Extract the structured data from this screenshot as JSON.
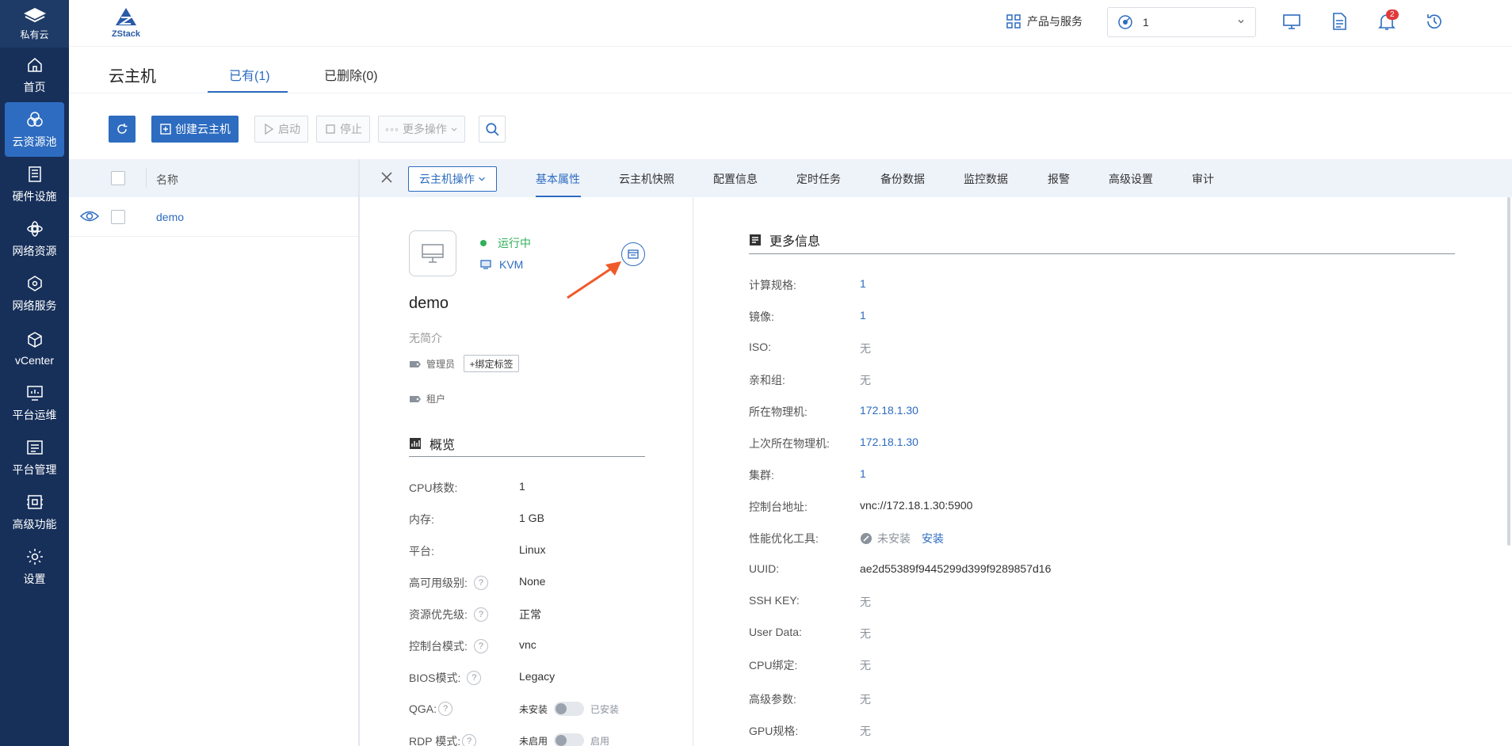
{
  "sidebar": {
    "brand": "私有云",
    "items": [
      {
        "label": "首页",
        "icon": "home-icon"
      },
      {
        "label": "云资源池",
        "icon": "cloud-pool-icon"
      },
      {
        "label": "硬件设施",
        "icon": "hardware-icon"
      },
      {
        "label": "网络资源",
        "icon": "network-resource-icon"
      },
      {
        "label": "网络服务",
        "icon": "network-service-icon"
      },
      {
        "label": "vCenter",
        "icon": "vcenter-icon"
      },
      {
        "label": "平台运维",
        "icon": "ops-icon"
      },
      {
        "label": "平台管理",
        "icon": "management-icon"
      },
      {
        "label": "高级功能",
        "icon": "advanced-icon"
      },
      {
        "label": "设置",
        "icon": "gear-icon"
      }
    ],
    "active_index": 1
  },
  "header": {
    "logo_text": "ZStack",
    "products_label": "产品与服务",
    "zone_value": "1",
    "notification_count": "2"
  },
  "page": {
    "title": "云主机",
    "tabs": [
      {
        "label": "已有(1)"
      },
      {
        "label": "已删除(0)"
      }
    ]
  },
  "toolbar": {
    "create_label": "创建云主机",
    "start_label": "启动",
    "stop_label": "停止",
    "more_label": "更多操作"
  },
  "list": {
    "header_name": "名称",
    "rows": [
      {
        "name": "demo"
      }
    ]
  },
  "detail": {
    "ops_label": "云主机操作",
    "tabs": [
      "基本属性",
      "云主机快照",
      "配置信息",
      "定时任务",
      "备份数据",
      "监控数据",
      "报警",
      "高级设置",
      "审计"
    ],
    "status": "运行中",
    "hypervisor": "KVM",
    "name": "demo",
    "description": "无简介",
    "owner_tag": "管理员",
    "bind_tag_label": "+绑定标签",
    "tenant_tag": "租户",
    "overview_title": "概览",
    "overview": [
      {
        "label": "CPU核数:",
        "value": "1"
      },
      {
        "label": "内存:",
        "value": "1 GB"
      },
      {
        "label": "平台:",
        "value": "Linux"
      },
      {
        "label": "高可用级别:",
        "value": "None"
      },
      {
        "label": "资源优先级:",
        "value": "正常"
      },
      {
        "label": "控制台模式:",
        "value": "vnc"
      },
      {
        "label": "BIOS模式:",
        "value": "Legacy"
      },
      {
        "label": "QGA:",
        "off": "未安装",
        "on": "已安装"
      },
      {
        "label": "RDP 模式:",
        "off": "未启用",
        "on": "启用"
      }
    ],
    "more_title": "更多信息",
    "more": [
      {
        "label": "计算规格:",
        "value": "1"
      },
      {
        "label": "镜像:",
        "value": "1"
      },
      {
        "label": "ISO:",
        "value": "无"
      },
      {
        "label": "亲和组:",
        "value": "无"
      },
      {
        "label": "所在物理机:",
        "value": "172.18.1.30"
      },
      {
        "label": "上次所在物理机:",
        "value": "172.18.1.30"
      },
      {
        "label": "集群:",
        "value": "1"
      },
      {
        "label": "控制台地址:",
        "value": "vnc://172.18.1.30:5900"
      },
      {
        "label": "性能优化工具:",
        "value": "未安装",
        "action": "安装"
      },
      {
        "label": "UUID:",
        "value": "ae2d55389f9445299d399f9289857d16"
      },
      {
        "label": "SSH KEY:",
        "value": "无"
      },
      {
        "label": "User Data:",
        "value": "无"
      },
      {
        "label": "CPU绑定:",
        "value": "无"
      },
      {
        "label": "高级参数:",
        "value": "无"
      },
      {
        "label": "GPU规格:",
        "value": "无"
      }
    ]
  }
}
